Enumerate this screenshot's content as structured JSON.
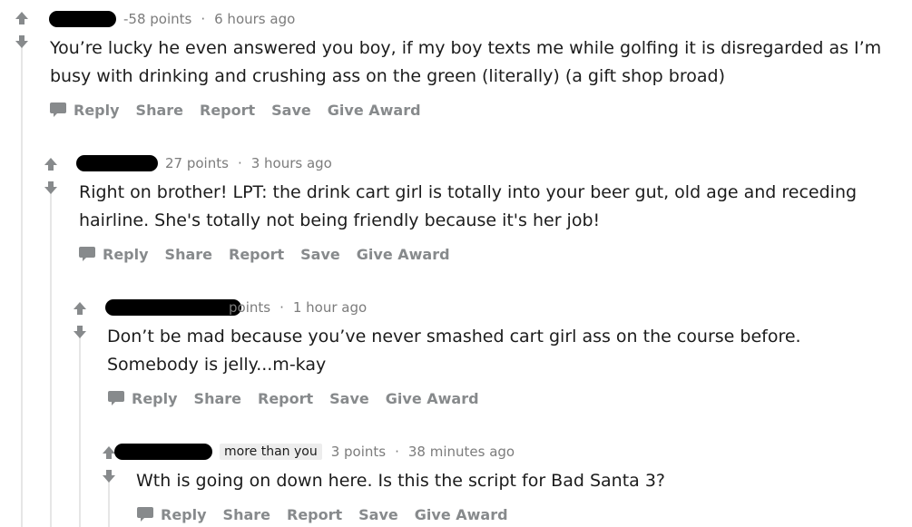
{
  "comments": [
    {
      "points": "-58 points",
      "time": "6 hours ago",
      "body": "You’re lucky he even answered you boy, if my boy texts me while golfing it is disregarded as I’m busy with drinking and crushing ass on the green (literally) (a gift shop broad)",
      "actions": {
        "reply": "Reply",
        "share": "Share",
        "report": "Report",
        "save": "Save",
        "award": "Give Award"
      }
    },
    {
      "points": "27 points",
      "time": "3 hours ago",
      "body": "Right on brother! LPT: the drink cart girl is totally into your beer gut, old age and receding hairline. She's totally not being friendly because it's her job!",
      "actions": {
        "reply": "Reply",
        "share": "Share",
        "report": "Report",
        "save": "Save",
        "award": "Give Award"
      }
    },
    {
      "points": "points",
      "time": "1 hour ago",
      "body": "Don’t be mad because you’ve never smashed cart girl ass on the course before. Somebody is jelly...m-kay",
      "actions": {
        "reply": "Reply",
        "share": "Share",
        "report": "Report",
        "save": "Save",
        "award": "Give Award"
      }
    },
    {
      "flair": "more than you",
      "points": "3 points",
      "time": "38 minutes ago",
      "body": "Wth is going on down here. Is this the script for Bad Santa 3?",
      "actions": {
        "reply": "Reply",
        "share": "Share",
        "report": "Report",
        "save": "Save",
        "award": "Give Award"
      }
    }
  ],
  "colors": {
    "meta": "#7c7c7c",
    "action": "#878a8c",
    "arrow": "#878a8c",
    "thread": "#e6e6e6"
  }
}
